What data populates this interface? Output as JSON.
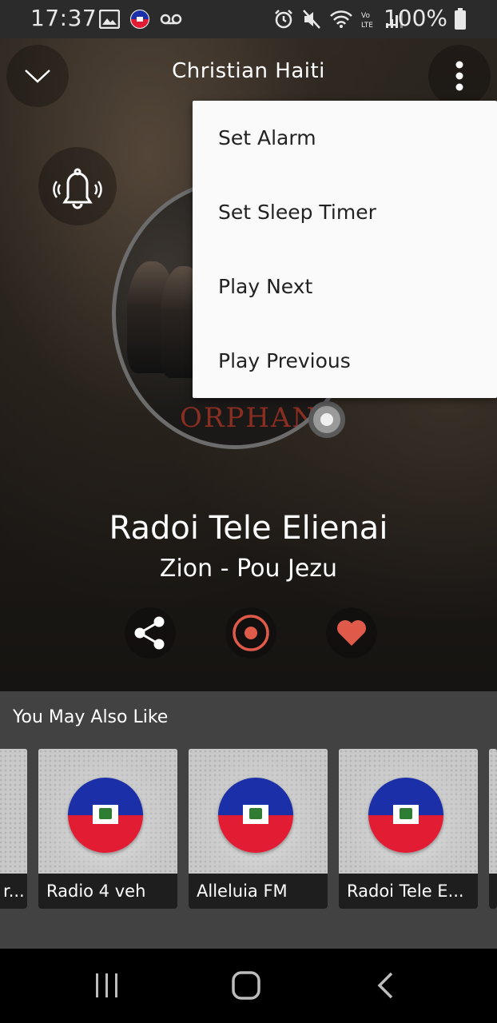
{
  "status_bar": {
    "time": "17:37",
    "battery": "100%",
    "left_icons": [
      "image-icon",
      "haiti-flag-icon",
      "voicemail-icon"
    ],
    "right_icons": [
      "alarm-icon",
      "mute-icon",
      "wifi-icon",
      "volte-icon",
      "signal-icon",
      "battery-icon"
    ]
  },
  "player": {
    "title": "Christian Haiti",
    "album_text": "ORPHANS",
    "station": "Radoi Tele Elienai",
    "track": "Zion - Pou Jezu"
  },
  "menu": {
    "items": [
      "Set Alarm",
      "Set Sleep Timer",
      "Play Next",
      "Play Previous"
    ]
  },
  "also_like": {
    "title": "You May Also Like",
    "cards": [
      {
        "label": "r..."
      },
      {
        "label": "Radio 4 veh"
      },
      {
        "label": "Alleluia FM"
      },
      {
        "label": "Radoi Tele E..."
      }
    ]
  },
  "colors": {
    "accent": "#e05a4a",
    "menu_bg": "#fafafa",
    "section_bg": "#424242",
    "flag_blue": "#1a2fa8",
    "flag_red": "#e21c32"
  }
}
